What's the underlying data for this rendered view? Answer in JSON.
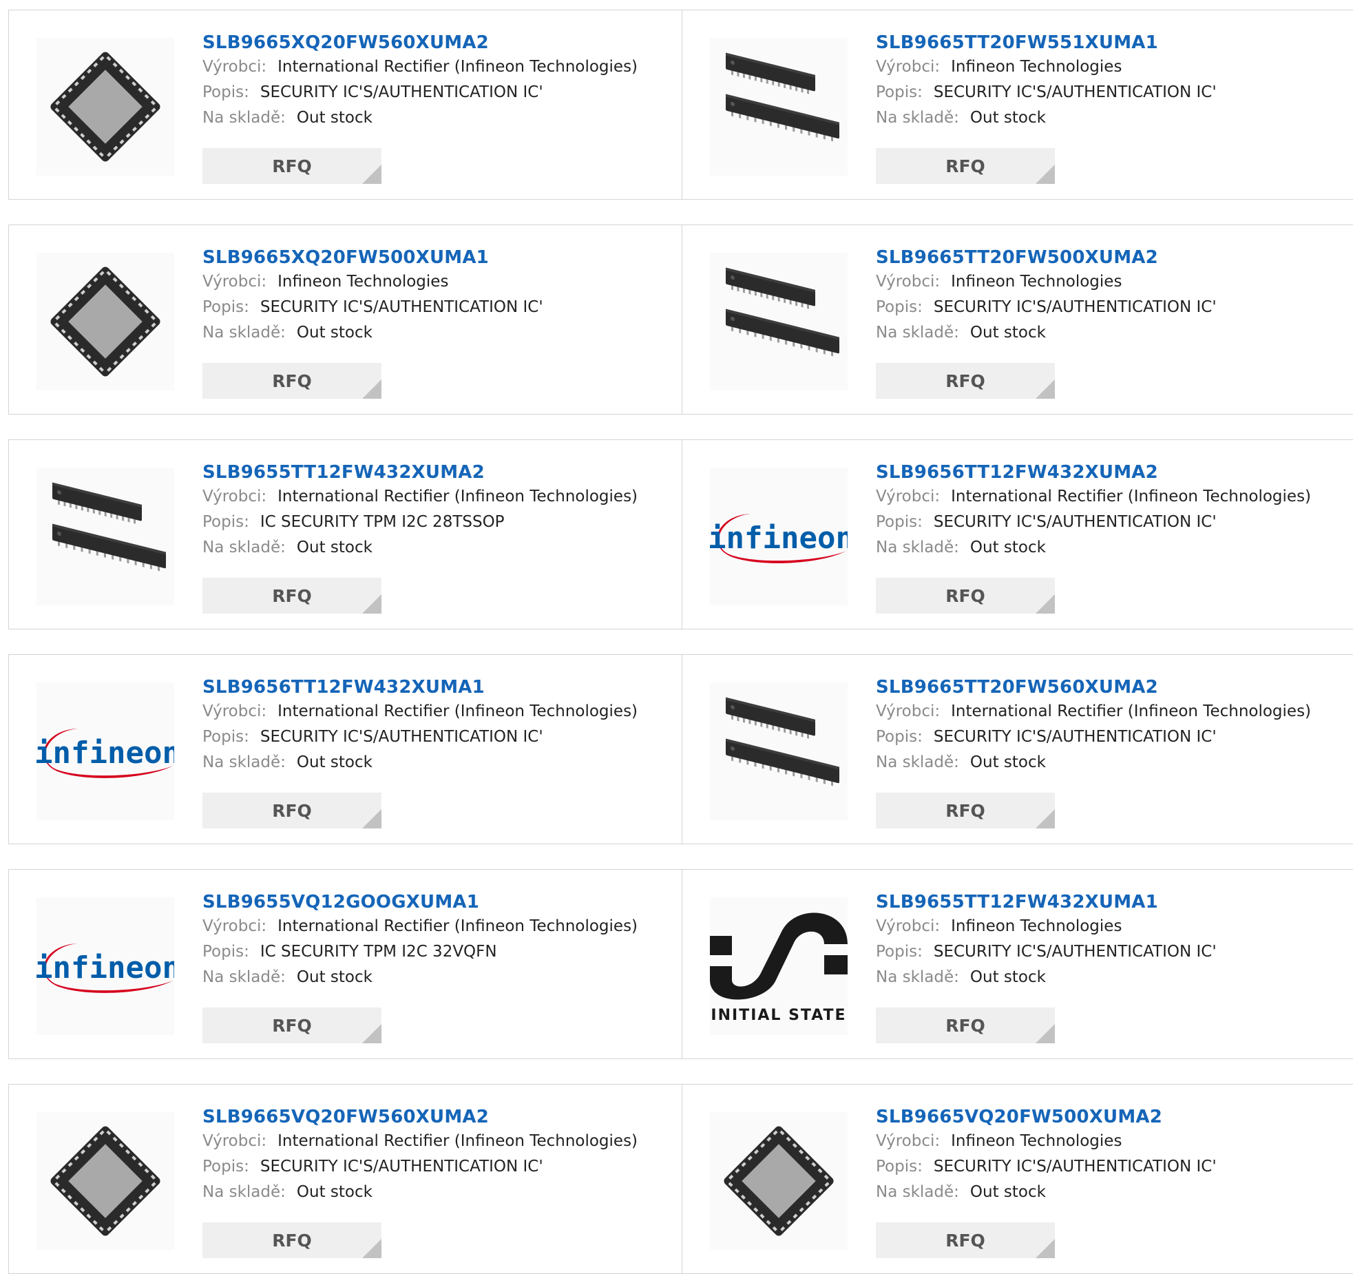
{
  "labels": {
    "manufacturer": "Výrobci:",
    "description": "Popis:",
    "stock": "Na skladě:",
    "rfq": "RFQ"
  },
  "theme": {
    "link_color": "#1565b8",
    "label_color": "#8a8a8a",
    "button_bg": "#efefef",
    "border_color": "#d4d4d4",
    "infineon_red": "#d6001c",
    "infineon_blue": "#005da9"
  },
  "products": [
    {
      "part": "SLB9665XQ20FW560XUMA2",
      "manufacturer": "International Rectifier (Infineon Technologies)",
      "description": "SECURITY IC'S/AUTHENTICATION IC'",
      "stock": "Out stock",
      "image": "qfn-chip-icon"
    },
    {
      "part": "SLB9665TT20FW551XUMA1",
      "manufacturer": "Infineon Technologies",
      "description": "SECURITY IC'S/AUTHENTICATION IC'",
      "stock": "Out stock",
      "image": "tssop-chip-icon"
    },
    {
      "part": "SLB9665XQ20FW500XUMA1",
      "manufacturer": "Infineon Technologies",
      "description": "SECURITY IC'S/AUTHENTICATION IC'",
      "stock": "Out stock",
      "image": "qfn-chip-icon"
    },
    {
      "part": "SLB9665TT20FW500XUMA2",
      "manufacturer": "Infineon Technologies",
      "description": "SECURITY IC'S/AUTHENTICATION IC'",
      "stock": "Out stock",
      "image": "tssop-chip-icon"
    },
    {
      "part": "SLB9655TT12FW432XUMA2",
      "manufacturer": "International Rectifier (Infineon Technologies)",
      "description": "IC SECURITY TPM I2C 28TSSOP",
      "stock": "Out stock",
      "image": "tssop-chip-icon"
    },
    {
      "part": "SLB9656TT12FW432XUMA2",
      "manufacturer": "International Rectifier (Infineon Technologies)",
      "description": "SECURITY IC'S/AUTHENTICATION IC'",
      "stock": "Out stock",
      "image": "infineon-logo"
    },
    {
      "part": "SLB9656TT12FW432XUMA1",
      "manufacturer": "International Rectifier (Infineon Technologies)",
      "description": "SECURITY IC'S/AUTHENTICATION IC'",
      "stock": "Out stock",
      "image": "infineon-logo"
    },
    {
      "part": "SLB9665TT20FW560XUMA2",
      "manufacturer": "International Rectifier (Infineon Technologies)",
      "description": "SECURITY IC'S/AUTHENTICATION IC'",
      "stock": "Out stock",
      "image": "tssop-chip-icon"
    },
    {
      "part": "SLB9655VQ12GOOGXUMA1",
      "manufacturer": "International Rectifier (Infineon Technologies)",
      "description": "IC SECURITY TPM I2C 32VQFN",
      "stock": "Out stock",
      "image": "infineon-logo"
    },
    {
      "part": "SLB9655TT12FW432XUMA1",
      "manufacturer": "Infineon Technologies",
      "description": "SECURITY IC'S/AUTHENTICATION IC'",
      "stock": "Out stock",
      "image": "initial-state-logo"
    },
    {
      "part": "SLB9665VQ20FW560XUMA2",
      "manufacturer": "International Rectifier (Infineon Technologies)",
      "description": "SECURITY IC'S/AUTHENTICATION IC'",
      "stock": "Out stock",
      "image": "qfn-chip-icon"
    },
    {
      "part": "SLB9665VQ20FW500XUMA2",
      "manufacturer": "Infineon Technologies",
      "description": "SECURITY IC'S/AUTHENTICATION IC'",
      "stock": "Out stock",
      "image": "qfn-chip-icon"
    }
  ],
  "logos": {
    "infineon_text": "infineon",
    "initial_state_text": "INITIAL STATE"
  }
}
